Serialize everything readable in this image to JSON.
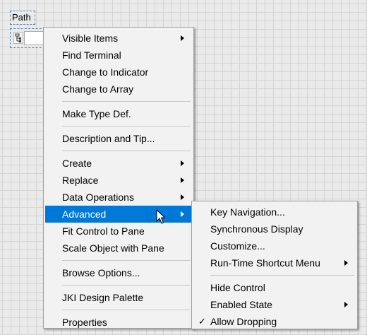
{
  "control": {
    "label": "Path"
  },
  "context_menu": {
    "items": [
      {
        "label": "Visible Items",
        "has_submenu": true
      },
      {
        "label": "Find Terminal"
      },
      {
        "label": "Change to Indicator"
      },
      {
        "label": "Change to Array"
      },
      {
        "label": "Make Type Def."
      },
      {
        "label": "Description and Tip..."
      },
      {
        "label": "Create",
        "has_submenu": true
      },
      {
        "label": "Replace",
        "has_submenu": true
      },
      {
        "label": "Data Operations",
        "has_submenu": true
      },
      {
        "label": "Advanced",
        "has_submenu": true,
        "highlighted": true
      },
      {
        "label": "Fit Control to Pane"
      },
      {
        "label": "Scale Object with Pane"
      },
      {
        "label": "Browse Options..."
      },
      {
        "label": "JKI Design Palette"
      },
      {
        "label": "Properties"
      }
    ]
  },
  "advanced_submenu": {
    "items": [
      {
        "label": "Key Navigation..."
      },
      {
        "label": "Synchronous Display"
      },
      {
        "label": "Customize..."
      },
      {
        "label": "Run-Time Shortcut Menu",
        "has_submenu": true
      },
      {
        "label": "Hide Control"
      },
      {
        "label": "Enabled State",
        "has_submenu": true
      },
      {
        "label": "Allow Dropping",
        "checked": true,
        "check_glyph": "✓"
      }
    ]
  },
  "colors": {
    "highlight": "#0078d7",
    "menu_background": "#f2f2f2",
    "panel_background": "#eaeaea",
    "grid_line": "#d4d4d4"
  }
}
